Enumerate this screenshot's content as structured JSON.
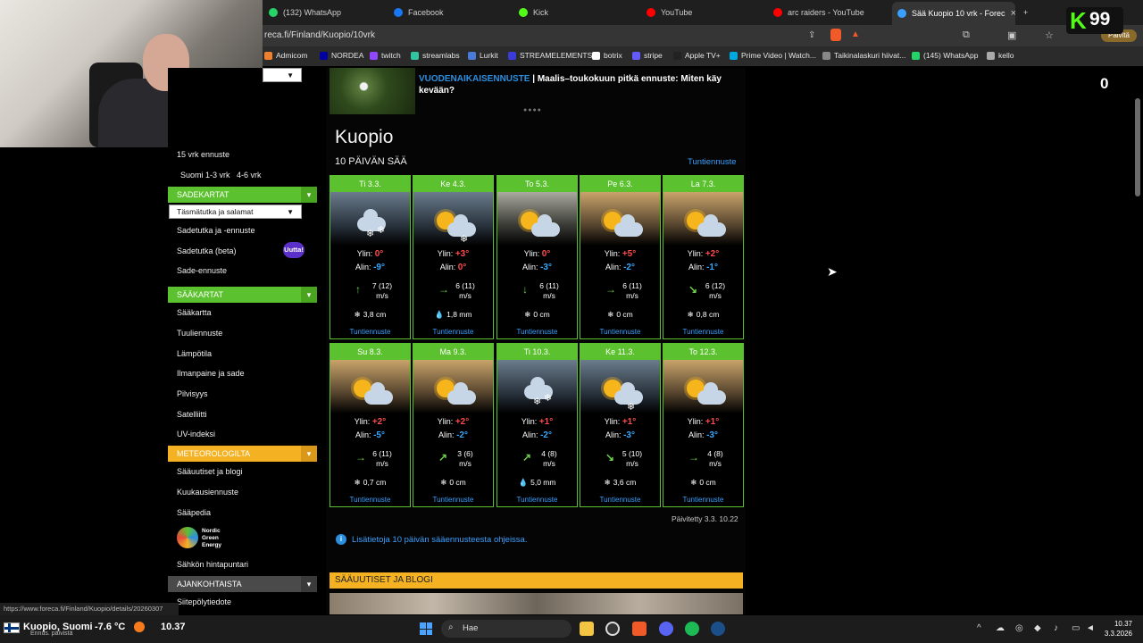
{
  "browser": {
    "tabs": [
      {
        "label": "(132) WhatsApp",
        "icon": "whatsapp-icon",
        "color": "#25d366"
      },
      {
        "label": "Facebook",
        "icon": "facebook-icon",
        "color": "#1877f2"
      },
      {
        "label": "Kick",
        "icon": "kick-icon",
        "color": "#53fc18"
      },
      {
        "label": "YouTube",
        "icon": "youtube-icon",
        "color": "#ff0000"
      },
      {
        "label": "arc raiders - YouTube",
        "icon": "youtube-icon",
        "color": "#ff0000"
      },
      {
        "label": "Sää Kuopio 10 vrk - Forec",
        "icon": "foreca-icon",
        "color": "#3aa0ff"
      }
    ],
    "close_label": "×",
    "new_tab_label": "+",
    "url": "reca.fi/Finland/Kuopio/10vrk",
    "bookmarks": [
      {
        "label": "Admicom",
        "color": "#f08030"
      },
      {
        "label": "NORDEA",
        "color": "#0000a0"
      },
      {
        "label": "twitch",
        "color": "#9146ff"
      },
      {
        "label": "streamlabs",
        "color": "#31c3a2"
      },
      {
        "label": "Lurkit",
        "color": "#4a7bd9"
      },
      {
        "label": "STREAMELEMENTS",
        "color": "#3b3bd9"
      },
      {
        "label": "botrix",
        "color": "#fff"
      },
      {
        "label": "stripe",
        "color": "#635bff"
      },
      {
        "label": "Apple TV+",
        "color": "#222"
      },
      {
        "label": "Prime Video | Watch...",
        "color": "#00a8e1"
      },
      {
        "label": "Taikinalaskuri hiivat...",
        "color": "#888"
      },
      {
        "label": "(145) WhatsApp",
        "color": "#25d366"
      },
      {
        "label": "kello",
        "color": "#aaa"
      }
    ],
    "update_label": "Päivitä",
    "status_url": "https://www.foreca.fi/Finland/Kuopio/details/20260307"
  },
  "overlay": {
    "kick_count": "99",
    "kick_letter": "K",
    "zero": "0"
  },
  "sidebar": {
    "items_top": [
      {
        "label": "15 vrk ennuste"
      }
    ],
    "sub_links": [
      "Suomi 1-3 vrk",
      "4-6 vrk"
    ],
    "section_rain": "SADEKARTAT",
    "rain_select": "Täsmätutka ja salamat",
    "rain_items": [
      "Sadetutka ja -ennuste",
      "Sadetutka (beta)",
      "Sade-ennuste"
    ],
    "new_badge": "Uutta!",
    "section_weather": "SÄÄKARTAT",
    "weather_items": [
      "Sääkartta",
      "Tuuliennuste",
      "Lämpötila",
      "Ilmanpaine ja sade",
      "Pilvisyys",
      "Satelliitti",
      "UV-indeksi"
    ],
    "section_meteo": "METEOROLOGILTA",
    "meteo_items": [
      "Sääuutiset ja blogi",
      "Kuukausiennuste",
      "Sääpedia"
    ],
    "nge_label": "Nordic Green Energy",
    "nge_lines": [
      "Nordic",
      "Green",
      "Energy"
    ],
    "price_label": "Sähkön hintapuntari",
    "section_current": "AJANKOHTAISTA",
    "current_items": [
      "Siitepölytiedote"
    ]
  },
  "promo": {
    "highlight": "VUODENAIKAISENNUSTE",
    "text": " | Maalis–toukokuun pitkä ennuste: Miten käy kevään?",
    "dots": "●●●●"
  },
  "main": {
    "city": "Kuopio",
    "subtitle": "10 PÄIVÄN SÄÄ",
    "hourly_link": "Tuntiennuste",
    "high_label": "Ylin:",
    "low_label": "Alin:",
    "wind_unit": "m/s",
    "updated": "Päivitetty 3.3. 10.22",
    "info": "Lisätietoja 10 päivän sääennusteesta ohjeissa.",
    "news_header": "SÄÄUUTISET JA BLOGI"
  },
  "days": [
    {
      "day": "Ti 3.3.",
      "sky": "snow",
      "high": "0°",
      "low": "-9°",
      "wind": "7 (12)",
      "wind_dir": "↑",
      "precip": "3,8 cm",
      "precip_type": "snow"
    },
    {
      "day": "Ke 4.3.",
      "sky": "partly-snow",
      "high": "+3°",
      "low": "0°",
      "wind": "6 (11)",
      "wind_dir": "→",
      "precip": "1,8 mm",
      "precip_type": "rain"
    },
    {
      "day": "To 5.3.",
      "sky": "partly-cloudy",
      "high": "0°",
      "low": "-3°",
      "wind": "6 (11)",
      "wind_dir": "↓",
      "precip": "0 cm",
      "precip_type": "snow"
    },
    {
      "day": "Pe 6.3.",
      "sky": "partly-cloudy",
      "high": "+5°",
      "low": "-2°",
      "wind": "6 (11)",
      "wind_dir": "→",
      "precip": "0 cm",
      "precip_type": "snow"
    },
    {
      "day": "La 7.3.",
      "sky": "partly-cloudy",
      "high": "+2°",
      "low": "-1°",
      "wind": "6 (12)",
      "wind_dir": "↘",
      "precip": "0,8 cm",
      "precip_type": "snow"
    },
    {
      "day": "Su 8.3.",
      "sky": "partly-cloudy",
      "high": "+2°",
      "low": "-5°",
      "wind": "6 (11)",
      "wind_dir": "→",
      "precip": "0,7 cm",
      "precip_type": "snow"
    },
    {
      "day": "Ma 9.3.",
      "sky": "partly-cloudy",
      "high": "+2°",
      "low": "-2°",
      "wind": "3 (6)",
      "wind_dir": "↗",
      "precip": "0 cm",
      "precip_type": "snow"
    },
    {
      "day": "Ti 10.3.",
      "sky": "snow",
      "high": "+1°",
      "low": "-2°",
      "wind": "4 (8)",
      "wind_dir": "↗",
      "precip": "5,0 mm",
      "precip_type": "rain"
    },
    {
      "day": "Ke 11.3.",
      "sky": "partly-snow",
      "high": "+1°",
      "low": "-3°",
      "wind": "5 (10)",
      "wind_dir": "↘",
      "precip": "3,6 cm",
      "precip_type": "snow"
    },
    {
      "day": "To 12.3.",
      "sky": "partly-cloudy",
      "high": "+1°",
      "low": "-3°",
      "wind": "4 (8)",
      "wind_dir": "→",
      "precip": "0 cm",
      "precip_type": "snow"
    }
  ],
  "taskbar": {
    "weather_city": "Kuopio, Suomi",
    "weather_temp": "-7.6 °C",
    "weather_sub": "Ennus. päivistä",
    "stream_time": "10.37",
    "search_placeholder": "Hae",
    "time": "10.37",
    "date": "3.3.2026"
  }
}
